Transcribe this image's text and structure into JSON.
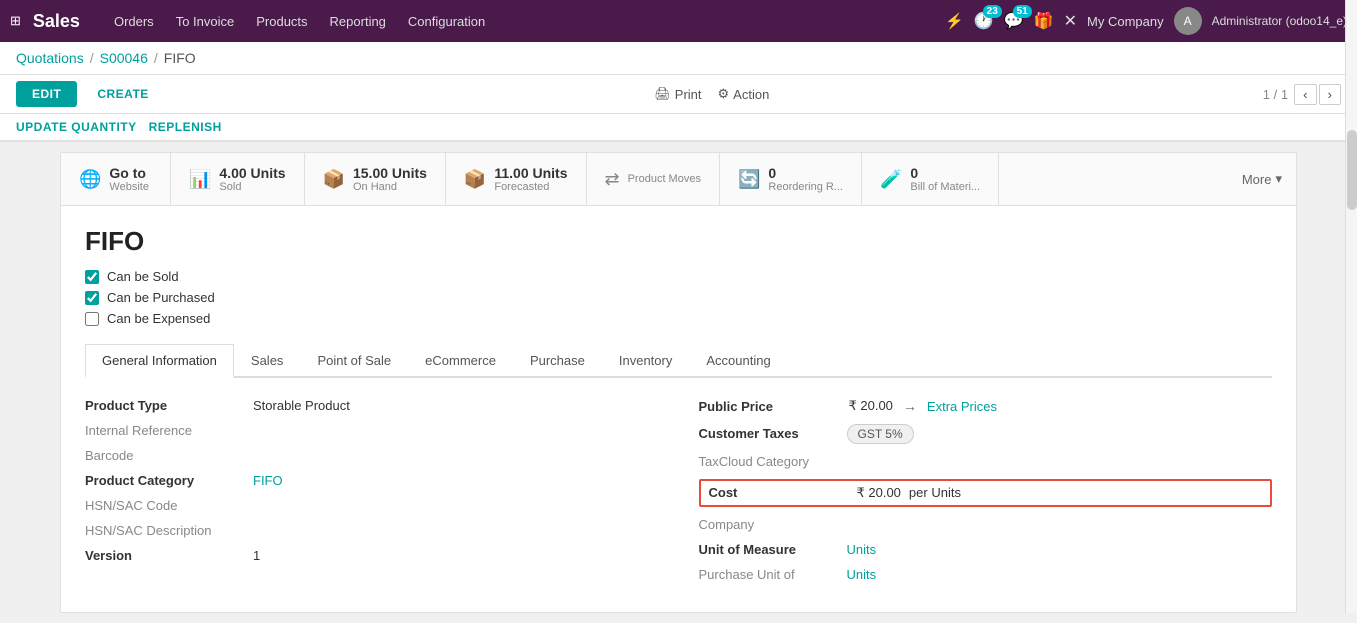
{
  "app": {
    "title": "Sales",
    "grid_icon": "⊞"
  },
  "nav": {
    "items": [
      "Orders",
      "To Invoice",
      "Products",
      "Reporting",
      "Configuration"
    ]
  },
  "top_right": {
    "bolt_icon": "⚡",
    "clock_badge": "23",
    "chat_badge": "51",
    "gift_icon": "🎁",
    "close_icon": "✕",
    "company": "My Company",
    "admin": "Administrator (odoo14_e)"
  },
  "breadcrumb": {
    "items": [
      "Quotations",
      "S00046",
      "FIFO"
    ]
  },
  "action_bar": {
    "edit_label": "EDIT",
    "create_label": "CREATE",
    "print_label": "Print",
    "action_label": "Action",
    "pager": "1 / 1"
  },
  "smart_bar": {
    "update_qty": "UPDATE QUANTITY",
    "replenish": "REPLENISH"
  },
  "stat_buttons": [
    {
      "icon": "🌐",
      "value": "Go to",
      "label": "Website",
      "type": "website"
    },
    {
      "icon": "📊",
      "value": "4.00 Units",
      "label": "Sold",
      "type": "sold"
    },
    {
      "icon": "📦",
      "value": "15.00 Units",
      "label": "On Hand",
      "type": "onhand"
    },
    {
      "icon": "📦",
      "value": "11.00 Units",
      "label": "Forecasted",
      "type": "forecast"
    },
    {
      "icon": "⇄",
      "value": "",
      "label": "Product Moves",
      "type": "moves"
    },
    {
      "icon": "🔄",
      "value": "0",
      "label": "Reordering R...",
      "type": "reorder"
    },
    {
      "icon": "🧪",
      "value": "0",
      "label": "Bill of Materi...",
      "type": "bom"
    }
  ],
  "more_label": "More",
  "product": {
    "name": "FIFO",
    "can_be_sold": true,
    "can_be_purchased": true,
    "can_be_expensed": false
  },
  "tabs": [
    {
      "label": "General Information",
      "active": true
    },
    {
      "label": "Sales",
      "active": false
    },
    {
      "label": "Point of Sale",
      "active": false
    },
    {
      "label": "eCommerce",
      "active": false
    },
    {
      "label": "Purchase",
      "active": false
    },
    {
      "label": "Inventory",
      "active": false
    },
    {
      "label": "Accounting",
      "active": false
    }
  ],
  "fields_left": {
    "product_type_label": "Product Type",
    "product_type_value": "Storable Product",
    "internal_ref_label": "Internal Reference",
    "internal_ref_value": "",
    "barcode_label": "Barcode",
    "barcode_value": "",
    "product_category_label": "Product Category",
    "product_category_value": "FIFO",
    "hsn_code_label": "HSN/SAC Code",
    "hsn_code_value": "",
    "hsn_desc_label": "HSN/SAC Description",
    "hsn_desc_value": "",
    "version_label": "Version",
    "version_value": "1"
  },
  "fields_right": {
    "public_price_label": "Public Price",
    "public_price_value": "₹ 20.00",
    "extra_prices_label": "Extra Prices",
    "customer_taxes_label": "Customer Taxes",
    "customer_taxes_value": "GST 5%",
    "taxcloud_label": "TaxCloud Category",
    "taxcloud_value": "",
    "cost_label": "Cost",
    "cost_value": "₹ 20.00",
    "cost_unit": "per Units",
    "company_label": "Company",
    "company_value": "",
    "uom_label": "Unit of Measure",
    "uom_value": "Units",
    "purchase_uom_label": "Purchase Unit of",
    "purchase_uom_value": "Units"
  },
  "checkboxes": {
    "sold_label": "Can be Sold",
    "purchased_label": "Can be Purchased",
    "expensed_label": "Can be Expensed"
  }
}
